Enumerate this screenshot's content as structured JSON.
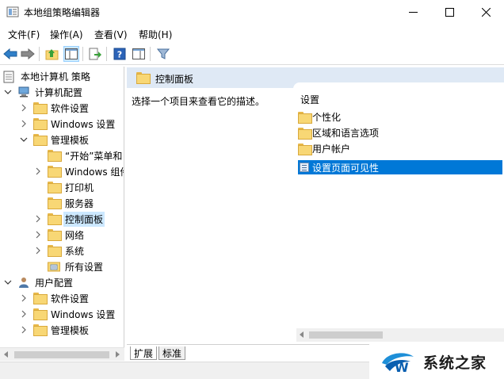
{
  "window": {
    "title": "本地组策略编辑器"
  },
  "menu": [
    "文件(F)",
    "操作(A)",
    "查看(V)",
    "帮助(H)"
  ],
  "tree": {
    "root": "本地计算机 策略",
    "computer_config": "计算机配置",
    "software_settings": "软件设置",
    "windows_settings": "Windows 设置",
    "admin_templates": "管理模板",
    "start_menu": "“开始”菜单和",
    "windows_components": "Windows 组件",
    "printers": "打印机",
    "server": "服务器",
    "control_panel": "控制面板",
    "network": "网络",
    "system": "系统",
    "all_settings": "所有设置",
    "user_config": "用户配置",
    "user_software_settings": "软件设置",
    "user_windows_settings": "Windows 设置",
    "user_admin_templates": "管理模板"
  },
  "details": {
    "header_title": "控制面板",
    "description": "选择一个项目来查看它的描述。",
    "list_header": "设置",
    "items": [
      "个性化",
      "区域和语言选项",
      "用户帐户",
      "设置页面可见性"
    ]
  },
  "tabs": [
    "扩展",
    "标准"
  ],
  "watermark": "系统之家",
  "colors": {
    "selection": "#0078d7",
    "tree_selection": "#cce8ff",
    "header_strip": "#dfe9f5"
  }
}
